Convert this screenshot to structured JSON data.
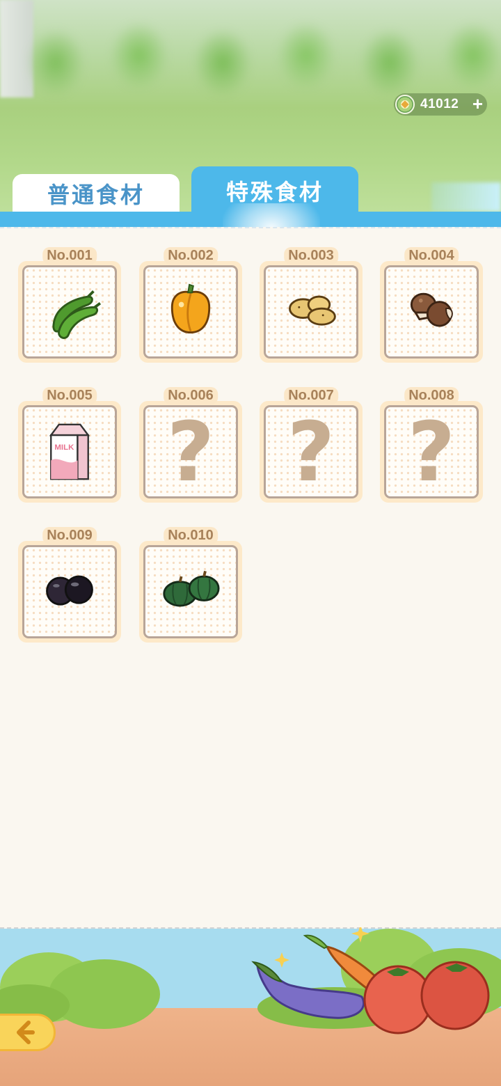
{
  "currency": {
    "amount": "41012",
    "icon": "coin-icon",
    "add_icon": "plus-icon"
  },
  "tabs": [
    {
      "label": "普通食材",
      "active": false
    },
    {
      "label": "特殊食材",
      "active": true
    }
  ],
  "ingredients": [
    {
      "no": "No.001",
      "icon": "green-pepper-icon",
      "unlocked": true
    },
    {
      "no": "No.002",
      "icon": "yellow-bell-pepper-icon",
      "unlocked": true
    },
    {
      "no": "No.003",
      "icon": "potato-icon",
      "unlocked": true
    },
    {
      "no": "No.004",
      "icon": "mushroom-icon",
      "unlocked": true
    },
    {
      "no": "No.005",
      "icon": "milk-carton-icon",
      "unlocked": true,
      "label": "MILK"
    },
    {
      "no": "No.006",
      "icon": "question-mark-icon",
      "unlocked": false,
      "label": "?"
    },
    {
      "no": "No.007",
      "icon": "question-mark-icon",
      "unlocked": false,
      "label": "?"
    },
    {
      "no": "No.008",
      "icon": "question-mark-icon",
      "unlocked": false,
      "label": "?"
    },
    {
      "no": "No.009",
      "icon": "black-fruit-icon",
      "unlocked": true
    },
    {
      "no": "No.010",
      "icon": "green-pumpkin-icon",
      "unlocked": true
    }
  ],
  "colors": {
    "accent": "#4db8ea",
    "card_bg": "#fde9c9",
    "number_text": "#a8825a",
    "back_button": "#f9d45a"
  },
  "back_button": {
    "icon": "back-arrow-icon"
  }
}
